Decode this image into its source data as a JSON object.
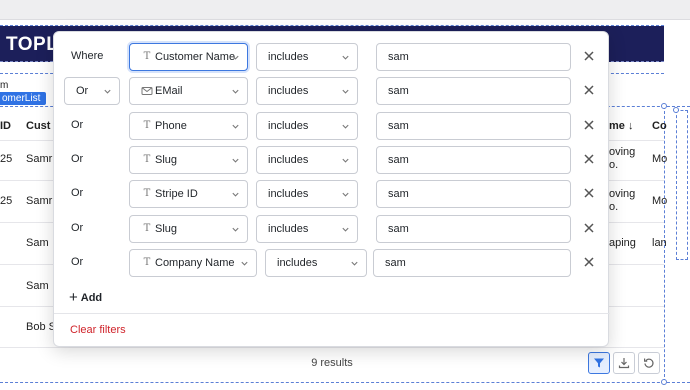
{
  "background": {
    "brand_text": "TOPLIN",
    "m_label": "m",
    "component_label": "omerList",
    "col_id": "ID",
    "col_customer": "Cust",
    "col_name_sorted": "me",
    "col_sort_icon": "arrow-down-icon",
    "col_co": "Co",
    "rows": [
      {
        "id": "25",
        "customer": "Samr",
        "right1": "oving",
        "right2": "o.",
        "co": "Mo"
      },
      {
        "id": "25",
        "customer": "Samr",
        "right1": "oving",
        "right2": "o.",
        "co": "Mo"
      },
      {
        "id": "",
        "customer": "Sam",
        "right1": "aping",
        "right2": "",
        "co": "lan"
      },
      {
        "id": "",
        "customer": "Sam",
        "right1": "",
        "right2": "",
        "co": ""
      },
      {
        "id": "",
        "customer": "Bob S",
        "right1": "",
        "right2": "",
        "co": ""
      }
    ],
    "results_text": "9 results",
    "toolbar": [
      {
        "icon": "filter-icon",
        "active": true
      },
      {
        "icon": "download-icon",
        "active": false
      },
      {
        "icon": "refresh-icon",
        "active": false
      }
    ]
  },
  "filter_popup": {
    "rows": [
      {
        "conjunction": "Where",
        "conjunction_is_select": false,
        "field_icon": "text-icon",
        "field": "Customer Name",
        "operator": "includes",
        "value": "sam"
      },
      {
        "conjunction": "Or",
        "conjunction_is_select": true,
        "field_icon": "mail-icon",
        "field": "EMail",
        "operator": "includes",
        "value": "sam"
      },
      {
        "conjunction": "Or",
        "conjunction_is_select": false,
        "field_icon": "text-icon",
        "field": "Phone",
        "operator": "includes",
        "value": "sam"
      },
      {
        "conjunction": "Or",
        "conjunction_is_select": false,
        "field_icon": "text-icon",
        "field": "Slug",
        "operator": "includes",
        "value": "sam"
      },
      {
        "conjunction": "Or",
        "conjunction_is_select": false,
        "field_icon": "text-icon",
        "field": "Stripe ID",
        "operator": "includes",
        "value": "sam"
      },
      {
        "conjunction": "Or",
        "conjunction_is_select": false,
        "field_icon": "text-icon",
        "field": "Slug",
        "operator": "includes",
        "value": "sam"
      },
      {
        "conjunction": "Or",
        "conjunction_is_select": false,
        "field_icon": "text-icon",
        "field": "Company Name",
        "operator": "includes",
        "value": "sam"
      }
    ],
    "add_label": "Add",
    "clear_label": "Clear filters"
  },
  "colors": {
    "navy": "#1c1f5a",
    "accent": "#3d78e0",
    "danger": "#d0242b"
  }
}
